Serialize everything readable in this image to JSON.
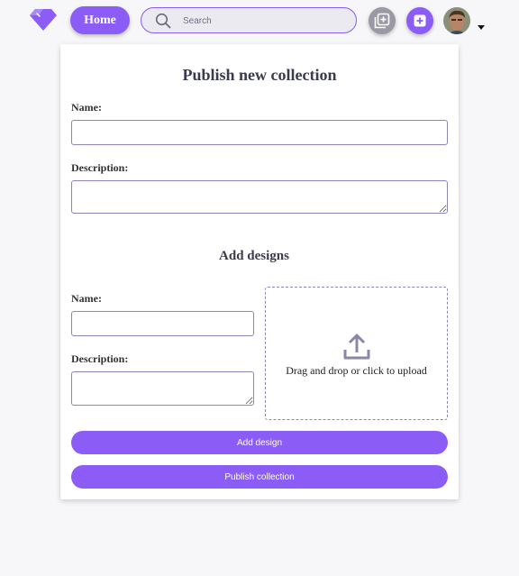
{
  "nav": {
    "home_label": "Home",
    "search_placeholder": "Search"
  },
  "form": {
    "title": "Publish new collection",
    "name_label": "Name:",
    "description_label": "Description:",
    "designs_title": "Add designs",
    "design_name_label": "Name:",
    "design_description_label": "Description:",
    "dropzone_text": "Drag and drop or click to upload",
    "add_design_label": "Add design",
    "publish_label": "Publish collection"
  },
  "colors": {
    "accent": "#8b5cf6",
    "background": "#f7f6f9",
    "border": "#8a87b8"
  }
}
